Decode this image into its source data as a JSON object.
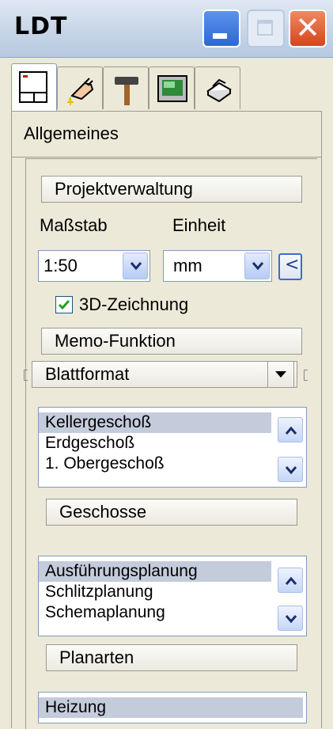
{
  "window": {
    "title": "LDT"
  },
  "tabs": [
    {
      "icon": "drawing-sheet-icon",
      "active": true
    },
    {
      "icon": "hand-sparkle-icon",
      "active": false
    },
    {
      "icon": "hammer-icon",
      "active": false
    },
    {
      "icon": "monitor-icon",
      "active": false
    },
    {
      "icon": "printer-icon",
      "active": false
    }
  ],
  "general": {
    "section_title": "Allgemeines",
    "project_button": "Projektverwaltung",
    "scale_label": "Maßstab",
    "unit_label": "Einheit",
    "scale_value": "1:50",
    "unit_value": "mm",
    "collapse_symbol": "<",
    "checkbox_label": "3D-Zeichnung",
    "checkbox_checked": true,
    "memo_button": "Memo-Funktion",
    "sheet_format_button": "Blattformat"
  },
  "floors": {
    "items": [
      "Kellergeschoß",
      "Erdgeschoß",
      "1. Obergeschoß"
    ],
    "selected": "Kellergeschoß",
    "button": "Geschosse"
  },
  "plan_types": {
    "items": [
      "Ausführungsplanung",
      "Schlitzplanung",
      "Schemaplanung"
    ],
    "selected": "Ausführungsplanung",
    "button": "Planarten"
  },
  "trades": {
    "items": [
      "Heizung"
    ],
    "selected": "Heizung"
  },
  "colors": {
    "selection": "#c4cbdb",
    "close_button": "#d6431d",
    "minimize_button": "#2d67d6"
  }
}
